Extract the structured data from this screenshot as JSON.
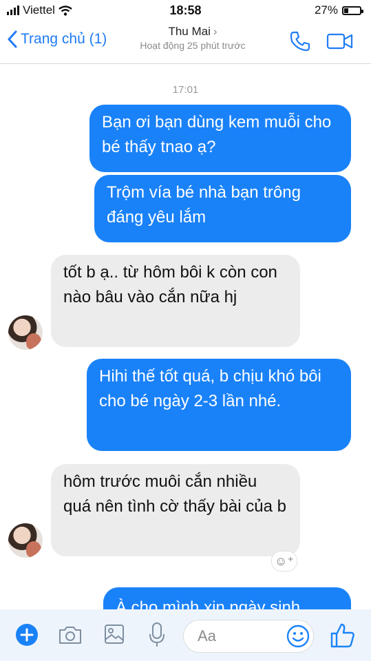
{
  "status_bar": {
    "carrier": "Viettel",
    "time": "18:58",
    "battery_percent": "27%",
    "battery_level": 0.27
  },
  "header": {
    "back_label": "Trang chủ (1)",
    "contact_name": "Thu Mai",
    "active_status": "Hoạt động 25 phút trước",
    "call_icon": "phone-icon",
    "video_icon": "video-icon"
  },
  "conversation": {
    "timestamp": "17:01",
    "messages": [
      {
        "from": "me",
        "text": "Bạn ơi bạn dùng kem muỗi cho bé thấy tnao ạ?"
      },
      {
        "from": "me",
        "text": "Trộm vía bé nhà bạn trông đáng yêu lắm"
      },
      {
        "from": "other",
        "text": "tốt b ạ.. từ hôm bôi k còn con nào bâu vào cắn nữa hj"
      },
      {
        "from": "me",
        "text": "Hihi thế tốt quá, b chịu khó bôi cho bé ngày 2-3 lần nhé."
      },
      {
        "from": "other",
        "text": "hôm trước muôi cắn nhiều quá nên tình cờ thấy bài của b"
      },
      {
        "from": "me",
        "text": "À cho mình xin ngày sinh"
      }
    ]
  },
  "composer": {
    "placeholder": "Aa",
    "icons": [
      "plus-icon",
      "camera-icon",
      "image-icon",
      "microphone-icon",
      "emoji-icon",
      "thumbs-up-icon"
    ]
  },
  "colors": {
    "accent": "#1a82f8",
    "incoming": "#ececec",
    "link": "#1f7bf3"
  }
}
